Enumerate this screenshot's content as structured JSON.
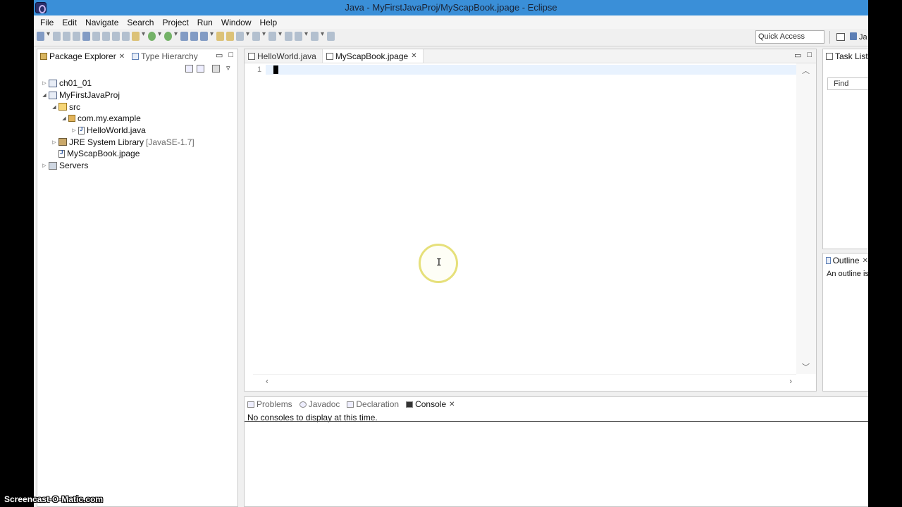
{
  "window": {
    "title": "Java - MyFirstJavaProj/MyScapBook.jpage - Eclipse"
  },
  "menu": [
    "File",
    "Edit",
    "Navigate",
    "Search",
    "Project",
    "Run",
    "Window",
    "Help"
  ],
  "toolbar": {
    "quick_access_placeholder": "Quick Access",
    "perspective_label": "Ja"
  },
  "package_explorer": {
    "tab_label": "Package Explorer",
    "other_tab_label": "Type Hierarchy",
    "tree": [
      {
        "label": "ch01_01"
      },
      {
        "label": "MyFirstJavaProj"
      },
      {
        "label": "src"
      },
      {
        "label": "com.my.example"
      },
      {
        "label": "HelloWorld.java"
      },
      {
        "label": "JRE System Library",
        "suffix": "[JavaSE-1.7]"
      },
      {
        "label": "MyScapBook.jpage"
      },
      {
        "label": "Servers"
      }
    ]
  },
  "editor": {
    "tabs": [
      "HelloWorld.java",
      "MyScapBook.jpage"
    ],
    "active_tab": "MyScapBook.jpage",
    "line_number": "1"
  },
  "task_list": {
    "tab_label": "Task List",
    "find_label": "Find"
  },
  "outline": {
    "tab_label": "Outline",
    "message": "An outline is"
  },
  "console": {
    "tabs": [
      "Problems",
      "Javadoc",
      "Declaration",
      "Console"
    ],
    "active_tab": "Console",
    "message": "No consoles to display at this time."
  },
  "watermark": "Screencast-O-Matic.com"
}
